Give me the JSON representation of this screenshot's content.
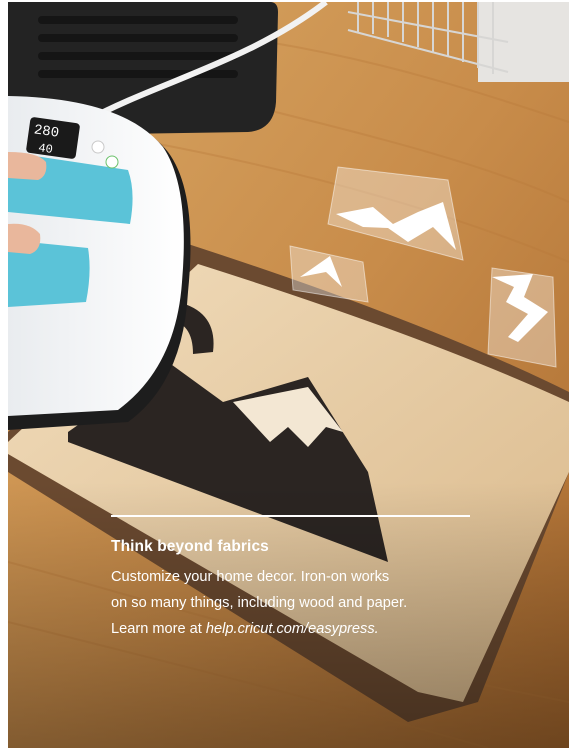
{
  "photo": {
    "subject": "heat press applying iron-on vinyl to wooden board",
    "display": {
      "temperature": "280",
      "time": "40"
    }
  },
  "caption": {
    "title": "Think beyond fabrics",
    "line1": "Customize your home decor. Iron-on works",
    "line2": "on so many things, including wood and paper.",
    "line3_prefix": "Learn more at ",
    "line3_link": "help.cricut.com/easypress."
  },
  "colors": {
    "wood": "#c98e4c",
    "plank": "#ead2ae",
    "vinyl": "#2b2522",
    "press_accent": "#5bc3d8"
  }
}
